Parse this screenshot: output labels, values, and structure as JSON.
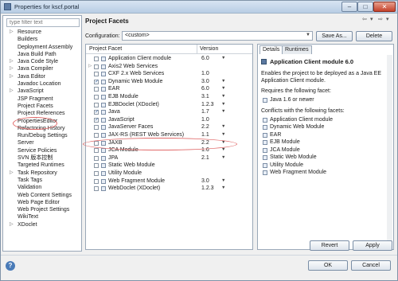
{
  "window": {
    "title": "Properties for kscf.portal"
  },
  "left": {
    "filter_placeholder": "type filter text",
    "items": [
      {
        "label": "Resource",
        "arrow": true
      },
      {
        "label": "Builders",
        "arrow": false
      },
      {
        "label": "Deployment Assembly",
        "arrow": false
      },
      {
        "label": "Java Build Path",
        "arrow": false
      },
      {
        "label": "Java Code Style",
        "arrow": true
      },
      {
        "label": "Java Compiler",
        "arrow": true
      },
      {
        "label": "Java Editor",
        "arrow": true
      },
      {
        "label": "Javadoc Location",
        "arrow": false
      },
      {
        "label": "JavaScript",
        "arrow": true
      },
      {
        "label": "JSP Fragment",
        "arrow": false
      },
      {
        "label": "Project Facets",
        "arrow": false,
        "selected": true
      },
      {
        "label": "Project References",
        "arrow": false
      },
      {
        "label": "PropertiesEditor",
        "arrow": false
      },
      {
        "label": "Refactoring History",
        "arrow": false
      },
      {
        "label": "Run/Debug Settings",
        "arrow": false
      },
      {
        "label": "Server",
        "arrow": false
      },
      {
        "label": "Service Policies",
        "arrow": false
      },
      {
        "label": "SVN 版本控制",
        "arrow": false
      },
      {
        "label": "Targeted Runtimes",
        "arrow": false
      },
      {
        "label": "Task Repository",
        "arrow": true
      },
      {
        "label": "Task Tags",
        "arrow": false
      },
      {
        "label": "Validation",
        "arrow": false
      },
      {
        "label": "Web Content Settings",
        "arrow": false
      },
      {
        "label": "Web Page Editor",
        "arrow": false
      },
      {
        "label": "Web Project Settings",
        "arrow": false
      },
      {
        "label": "WikiText",
        "arrow": false
      },
      {
        "label": "XDoclet",
        "arrow": true
      }
    ]
  },
  "main": {
    "title": "Project Facets",
    "configuration_label": "Configuration:",
    "configuration_value": "<custom>",
    "save_as_label": "Save As...",
    "delete_label": "Delete",
    "col_facet": "Project Facet",
    "col_version": "Version",
    "facets": [
      {
        "name": "Application Client module",
        "version": "6.0",
        "checked": false,
        "dd": true,
        "expand": false
      },
      {
        "name": "Axis2 Web Services",
        "version": "",
        "checked": false,
        "dd": false,
        "expand": true
      },
      {
        "name": "CXF 2.x Web Services",
        "version": "1.0",
        "checked": false,
        "dd": false,
        "expand": false
      },
      {
        "name": "Dynamic Web Module",
        "version": "3.0",
        "checked": true,
        "dd": true,
        "expand": false
      },
      {
        "name": "EAR",
        "version": "6.0",
        "checked": false,
        "dd": true,
        "expand": false
      },
      {
        "name": "EJB Module",
        "version": "3.1",
        "checked": false,
        "dd": true,
        "expand": false
      },
      {
        "name": "EJBDoclet (XDoclet)",
        "version": "1.2.3",
        "checked": false,
        "dd": true,
        "expand": false
      },
      {
        "name": "Java",
        "version": "1.7",
        "checked": true,
        "dd": true,
        "expand": false
      },
      {
        "name": "JavaScript",
        "version": "1.0",
        "checked": true,
        "dd": false,
        "expand": false
      },
      {
        "name": "JavaServer Faces",
        "version": "2.2",
        "checked": false,
        "dd": true,
        "expand": false
      },
      {
        "name": "JAX-RS (REST Web Services)",
        "version": "1.1",
        "checked": false,
        "dd": true,
        "expand": false
      },
      {
        "name": "JAXB",
        "version": "2.2",
        "checked": false,
        "dd": true,
        "expand": false
      },
      {
        "name": "JCA Module",
        "version": "1.6",
        "checked": false,
        "dd": true,
        "expand": false
      },
      {
        "name": "JPA",
        "version": "2.1",
        "checked": false,
        "dd": true,
        "expand": false
      },
      {
        "name": "Static Web Module",
        "version": "",
        "checked": false,
        "dd": false,
        "expand": false
      },
      {
        "name": "Utility Module",
        "version": "",
        "checked": false,
        "dd": false,
        "expand": false
      },
      {
        "name": "Web Fragment Module",
        "version": "3.0",
        "checked": false,
        "dd": true,
        "expand": false
      },
      {
        "name": "WebDoclet (XDoclet)",
        "version": "1.2.3",
        "checked": false,
        "dd": true,
        "expand": false
      }
    ],
    "details": {
      "tab_details": "Details",
      "tab_runtimes": "Runtimes",
      "title": "Application Client module 6.0",
      "description": "Enables the project to be deployed as a Java EE Application Client module.",
      "requires_label": "Requires the following facet:",
      "requires_item": "Java 1.6 or newer",
      "conflicts_label": "Conflicts with the following facets:",
      "conflicts": [
        "Application Client module",
        "Dynamic Web Module",
        "EAR",
        "EJB Module",
        "JCA Module",
        "Static Web Module",
        "Utility Module",
        "Web Fragment Module"
      ]
    },
    "revert_label": "Revert",
    "apply_label": "Apply"
  },
  "footer": {
    "ok_label": "OK",
    "cancel_label": "Cancel"
  }
}
